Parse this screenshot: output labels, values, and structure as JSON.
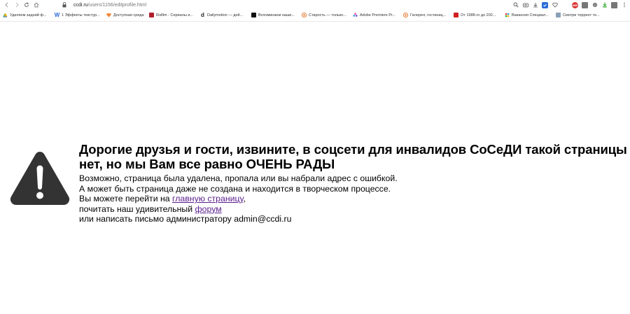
{
  "browser": {
    "url_host": "ccdi.ru",
    "url_path": "/users/1156/editprofile.html",
    "nav_icons": [
      "back-icon",
      "forward-icon",
      "reload-icon",
      "home-icon"
    ],
    "ext_label_red": "ABP"
  },
  "bookmarks": [
    {
      "label": "Удаляем задний ф...",
      "icon": "google-drive-icon",
      "color": "#1e8e3e"
    },
    {
      "label": "1 Эффекты текстур...",
      "icon": "w-icon",
      "color": "#2a6bd8"
    },
    {
      "label": "Доступная среда",
      "icon": "heart-icon",
      "color": "#f0883c"
    },
    {
      "label": "Rufilm - Сериалы и...",
      "icon": "film-icon",
      "color": "#b0202a"
    },
    {
      "label": "Dailymotion — дей...",
      "icon": "d-icon",
      "color": "#222222"
    },
    {
      "label": "Вспоминаем наши...",
      "icon": "ss-icon",
      "color": "#111111"
    },
    {
      "label": "Старость — только...",
      "icon": "swirl-icon",
      "color": "#e07a30"
    },
    {
      "label": "Adobe Premiere Pr...",
      "icon": "flower-icon",
      "color": "#7a4fd8"
    },
    {
      "label": "Галерея, гостиниц...",
      "icon": "swirl-icon",
      "color": "#e07a30"
    },
    {
      "label": "От 1988-го до 202...",
      "icon": "shield-icon",
      "color": "#d02020"
    },
    {
      "label": "Вакансия Специал...",
      "icon": "hh-icon",
      "color": "#555555"
    },
    {
      "label": "Смотри торрент те...",
      "icon": "doc-icon",
      "color": "#8aa0b8"
    }
  ],
  "page": {
    "headline": "Дорогие друзья и гости, извините, в соцсети для инвалидов СоСеДИ такой страницы нет, но мы Вам все равно ОЧЕНЬ РАДЫ",
    "line1": "Возможно, страница была удалена, пропала или вы набрали адрес с ошибкой.",
    "line2": "А может быть страница даже не создана и находится в творческом процессе.",
    "line3_prefix": "Вы можете перейти на ",
    "home_link": "главную страницу",
    "line3_suffix": ",",
    "line4_prefix": "почитать наш удивительный ",
    "forum_link": "форум",
    "line5": "или написать письмо администратору admin@ccdi.ru"
  }
}
